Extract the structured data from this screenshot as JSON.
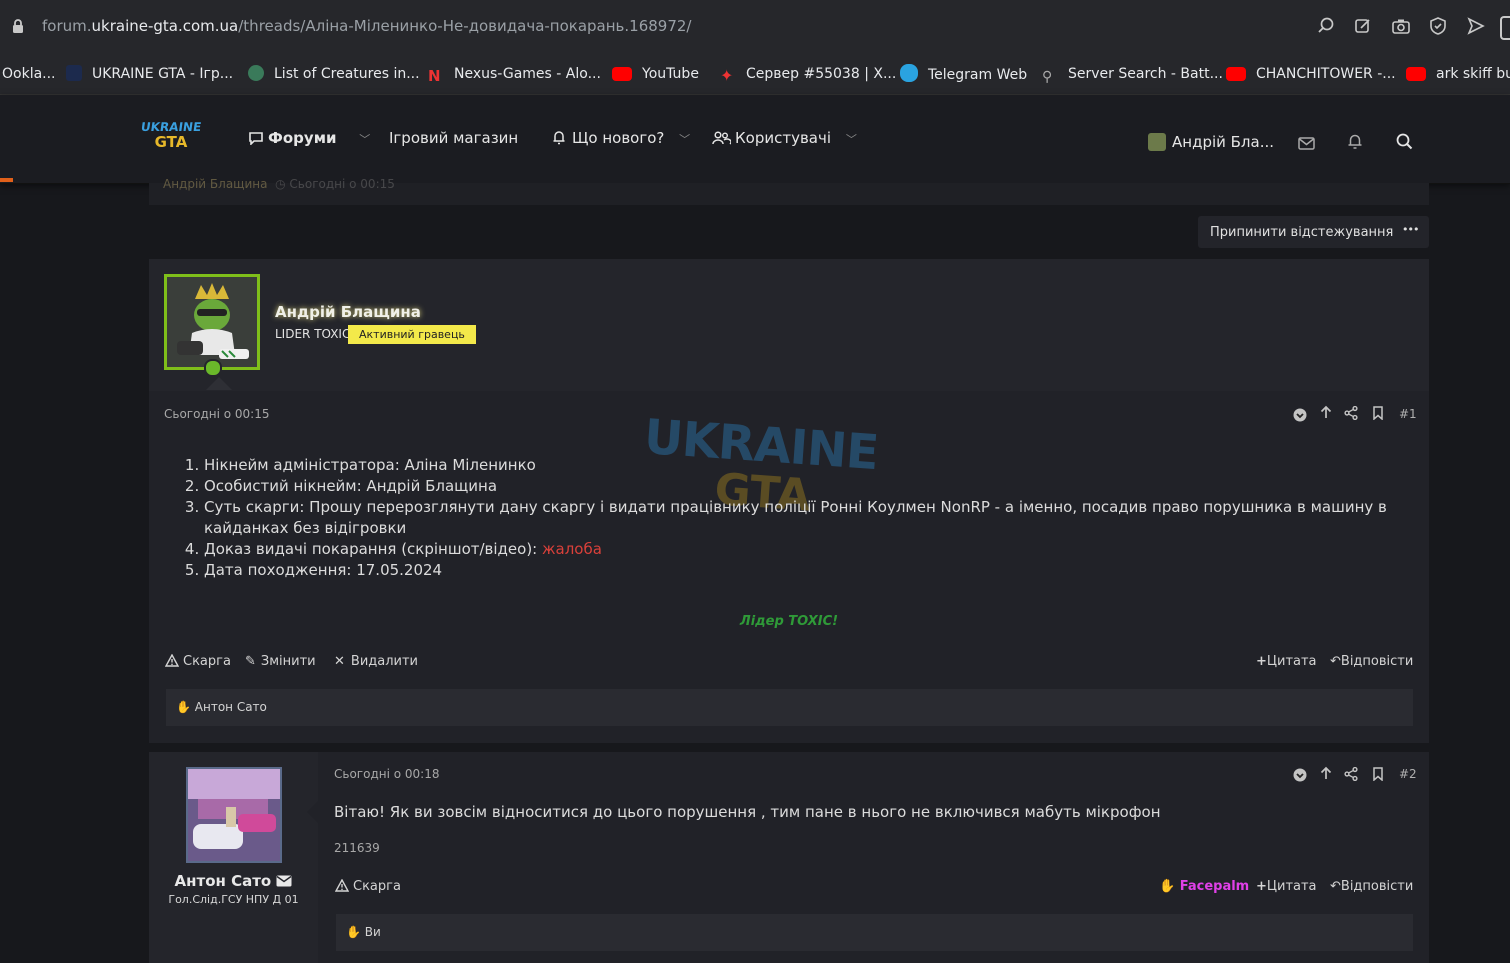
{
  "browser": {
    "url_prefix": "forum.",
    "url_domain": "ukraine-gta.com.ua",
    "url_path": "/threads/Аліна-Міленинко-Не-довидача-покарань.168972/",
    "icons": [
      "search-icon",
      "edit-icon",
      "camera-icon",
      "shield-icon",
      "send-icon"
    ]
  },
  "bookmarks": [
    {
      "label": "Ookla...",
      "color": "#26272b"
    },
    {
      "label": "UKRAINE GTA - Ігр...",
      "color": "#2a3d6b"
    },
    {
      "label": "List of Creatures in...",
      "color": "#3a7a5a"
    },
    {
      "label": "Nexus-Games - Alo...",
      "color": "#d33"
    },
    {
      "label": "YouTube",
      "color": "#f00"
    },
    {
      "label": "Сервер #55038 | X...",
      "color": "#d33"
    },
    {
      "label": "Telegram Web",
      "color": "#2aa3e0"
    },
    {
      "label": "Server Search - Batt...",
      "color": "#888"
    },
    {
      "label": "CHANCHITOWER -...",
      "color": "#f00"
    },
    {
      "label": "ark skiff bu",
      "color": "#f00"
    }
  ],
  "site": {
    "logo_top": "UKRAINE",
    "logo_bottom": "GTA",
    "nav": {
      "forums": "Форуми",
      "store": "Ігровий магазин",
      "whats_new": "Що нового?",
      "users": "Користувачі"
    },
    "account_name": "Андрій Бла..."
  },
  "thread": {
    "ghost_author": "Андрій Блащина",
    "ghost_time": "Сьогодні о 00:15",
    "unwatch_label": "Припинити відстежування",
    "more_label": "•••"
  },
  "post1": {
    "author": "Андрій Блащина",
    "user_title": "LIDER TOXIC",
    "banner": "Активний гравець",
    "time": "Сьогодні о 00:15",
    "number": "#1",
    "items": [
      {
        "text": "Нікнейм адміністратора: Аліна Міленинко"
      },
      {
        "text": "Особистий нікнейм: Андрій Блащина"
      },
      {
        "text": "Суть скарги: Прошу перерозглянути дану скаргу і видати працівнику поліції Ронні Коулмен NonRP - а іменно, посадив право порушника в машину в кайданках без відігровки"
      },
      {
        "text": "Доказ видачі покарання (скріншот/відео): ",
        "link": "жалоба"
      },
      {
        "text": "Дата походження: 17.05.2024"
      }
    ],
    "signature": "Лідер TOXIC!",
    "actions": {
      "report": "Скарга",
      "edit": "Змінити",
      "delete": "Видалити",
      "quote": "Цитата",
      "reply": "Відповісти"
    },
    "reaction_user": "Антон Сато",
    "watermark_top": "UKRAINE",
    "watermark_bottom": "GTA"
  },
  "post2": {
    "author": "Антон Сато",
    "user_title": "Гол.Слід.ГСУ НПУ Д 01",
    "time": "Сьогодні о 00:18",
    "number": "#2",
    "message": "Вітаю! Як ви зовсім відноситися до цього порушення , тим пане в нього не включився мабуть мікрофон",
    "signature": "211639",
    "actions": {
      "report": "Скарга",
      "reaction": "Facepalm",
      "quote": "Цитата",
      "reply": "Відповісти"
    },
    "reaction_user": "Ви"
  },
  "colors": {
    "accent_green": "#7fbf1a",
    "banner_yellow": "#f3e94a",
    "link_red": "#d9403a",
    "signature_green": "#2f9a38",
    "facepalm_magenta": "#e040e8",
    "progress_orange": "#e0601a"
  }
}
